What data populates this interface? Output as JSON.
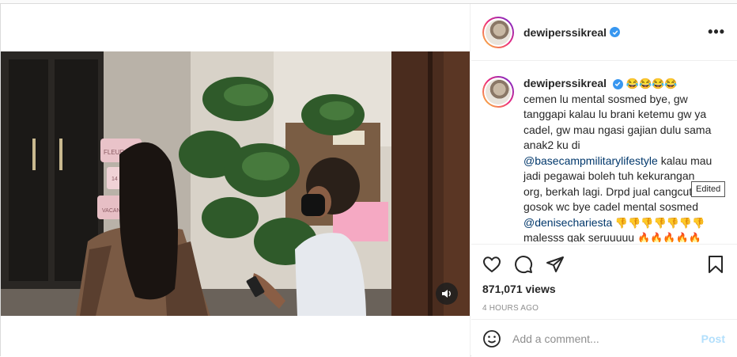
{
  "post": {
    "username": "dewiperssikreal",
    "verified": true,
    "more_label": "•••"
  },
  "video": {
    "volume_icon": "speaker-icon",
    "sign_texts": [
      "FLEUR DE",
      "14 FE",
      "VACAN"
    ]
  },
  "caption": {
    "username": "dewiperssikreal",
    "emoji_header": "😂😂😂😂",
    "line1": "cemen lu mental sosmed bye, gw tanggapi kalau lu brani ketemu gw ya cadel, gw mau ngasi gajian dulu sama anak2 ku di ",
    "mention1": "@basecampmilitarylifestyle",
    "line2": " kalau mau jadi pegawai boleh tuh kekurangan org, berkah lagi. Drpd jual cangcut gosok wc bye cadel mental sosmed ",
    "mention2": "@denisechariesta",
    "thumbs": " 👎👎👎👎👎👎👎",
    "line3": "malesss gak seruuuuu ",
    "fires": "🔥🔥🔥🔥🔥🔥",
    "tooltip": "Edited"
  },
  "actions": {
    "like_icon": "heart-icon",
    "comment_icon": "comment-icon",
    "share_icon": "share-icon",
    "save_icon": "bookmark-icon"
  },
  "stats": {
    "views": "871,071 views",
    "time": "4 HOURS AGO"
  },
  "comment_box": {
    "emoji_icon": "smiley-icon",
    "placeholder": "Add a comment...",
    "post_label": "Post"
  },
  "colors": {
    "verified": "#3897f0",
    "link": "#00376b",
    "post_disabled": "#b2dffc",
    "muted": "#8e8e8e"
  }
}
